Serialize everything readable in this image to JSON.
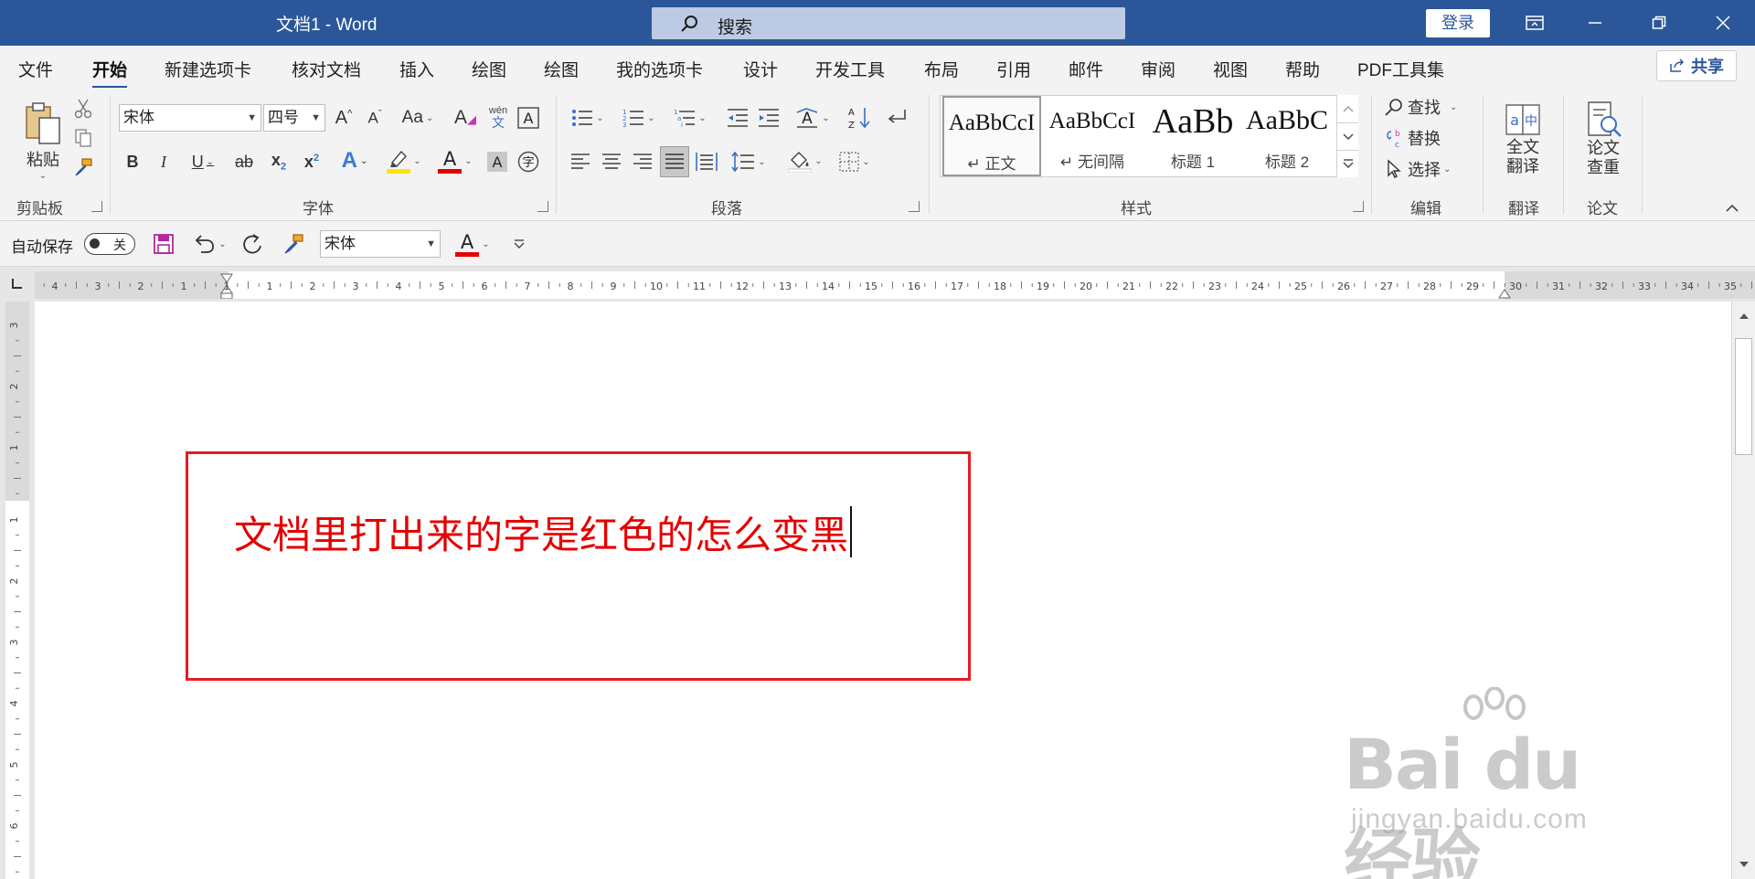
{
  "window": {
    "title": "文档1  -  Word",
    "search_placeholder": "搜索",
    "login_label": "登录"
  },
  "menu": {
    "items": [
      "文件",
      "开始",
      "新建选项卡",
      "核对文档",
      "插入",
      "绘图",
      "绘图",
      "我的选项卡",
      "设计",
      "开发工具",
      "布局",
      "引用",
      "邮件",
      "审阅",
      "视图",
      "帮助",
      "PDF工具集"
    ],
    "active": "开始",
    "share_label": "共享"
  },
  "ribbon": {
    "clipboard": {
      "paste_label": "粘贴",
      "group_label": "剪贴板"
    },
    "font": {
      "font_name": "宋体",
      "font_size": "四号",
      "group_label": "字体",
      "case_label": "Aa",
      "phonetic_top": "wén",
      "phonetic_bottom": "文"
    },
    "paragraph": {
      "group_label": "段落"
    },
    "styles": {
      "group_label": "样式",
      "items": [
        {
          "sample": "AaBbCcI",
          "name": "↵ 正文"
        },
        {
          "sample": "AaBbCcI",
          "name": "↵ 无间隔"
        },
        {
          "sample": "AaBb",
          "name": "标题 1"
        },
        {
          "sample": "AaBbC",
          "name": "标题 2"
        }
      ]
    },
    "editing": {
      "find_label": "查找",
      "replace_label": "替换",
      "select_label": "选择",
      "group_label": "编辑"
    },
    "translate": {
      "button_line1": "全文",
      "button_line2": "翻译",
      "group_label": "翻译"
    },
    "paper": {
      "button_line1": "论文",
      "button_line2": "查重",
      "group_label": "论文"
    }
  },
  "qat": {
    "autosave_label": "自动保存",
    "toggle_state": "关",
    "font_name": "宋体"
  },
  "ruler": {
    "h_labels": [
      "4",
      "3",
      "2",
      "1",
      "1",
      "1",
      "2",
      "3",
      "4",
      "5",
      "6",
      "7",
      "8",
      "9",
      "10",
      "11",
      "12",
      "13",
      "14",
      "15",
      "16",
      "17",
      "18",
      "19",
      "20",
      "21",
      "22",
      "23",
      "24",
      "25",
      "26",
      "27",
      "28",
      "29",
      "30",
      "31",
      "32",
      "33",
      "34",
      "35"
    ],
    "v_labels": [
      "3",
      "2",
      "1",
      "1",
      "2",
      "3",
      "4",
      "5",
      "6"
    ]
  },
  "document": {
    "text": "文档里打出来的字是红色的怎么变黑",
    "text_color": "#e50000"
  },
  "watermark": {
    "brand": "Bai du 经验",
    "url": "jingyan.baidu.com"
  },
  "colors": {
    "accent": "#2b579a",
    "annotation": "#e51c23",
    "highlight": "#ffe400",
    "font_color": "#e50000"
  }
}
